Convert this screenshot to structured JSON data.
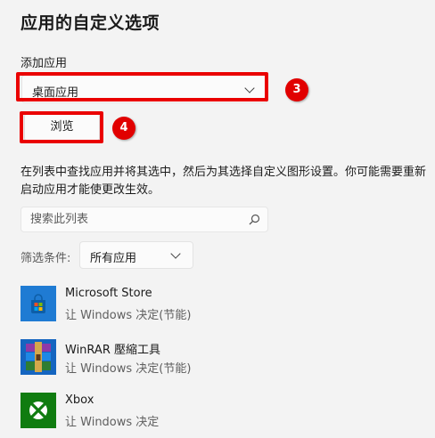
{
  "page": {
    "title": "应用的自定义选项",
    "add_app_label": "添加应用",
    "add_app_dropdown_value": "桌面应用",
    "browse_label": "浏览",
    "description": "在列表中查找应用并将其选中，然后为其选择自定义图形设置。你可能需要重新启动应用才能使更改生效。",
    "search_placeholder": "搜索此列表",
    "filter_label": "筛选条件:",
    "filter_value": "所有应用"
  },
  "annotations": {
    "badge_dropdown": "3",
    "badge_browse": "4",
    "highlight_color": "#ea0000"
  },
  "apps": [
    {
      "name": "Microsoft Store",
      "detail": "让 Windows 决定(节能)",
      "icon": "microsoft-store-icon",
      "color": "#1f7bd3"
    },
    {
      "name": "WinRAR 壓縮工具",
      "detail": "让 Windows 决定(节能)",
      "icon": "winrar-icon",
      "color": "#1565c0"
    },
    {
      "name": "Xbox",
      "detail": "让 Windows 决定",
      "icon": "xbox-icon",
      "color": "#107c10"
    }
  ]
}
